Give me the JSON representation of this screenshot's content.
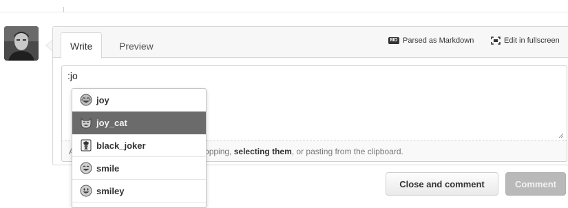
{
  "tabs": {
    "write": "Write",
    "preview": "Preview"
  },
  "toolbar": {
    "markdown_badge": "MD",
    "markdown_label": "Parsed as Markdown",
    "fullscreen_label": "Edit in fullscreen"
  },
  "editor": {
    "value": ":jo",
    "attach_prefix": "A",
    "attach_middle": "opping, ",
    "attach_highlight": "selecting them",
    "attach_suffix": ", or pasting from the clipboard."
  },
  "suggestions": [
    {
      "name": "joy",
      "icon": "joy-emoji-icon",
      "selected": false
    },
    {
      "name": "joy_cat",
      "icon": "joy-cat-emoji-icon",
      "selected": true
    },
    {
      "name": "black_joker",
      "icon": "black-joker-emoji-icon",
      "selected": false
    },
    {
      "name": "smile",
      "icon": "smile-emoji-icon",
      "selected": false
    },
    {
      "name": "smiley",
      "icon": "smiley-emoji-icon",
      "selected": false
    }
  ],
  "buttons": {
    "close_comment": "Close and comment",
    "comment": "Comment"
  }
}
